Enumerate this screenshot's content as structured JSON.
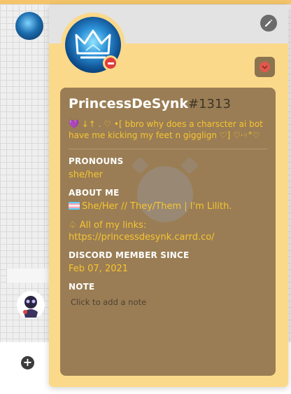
{
  "background": {
    "add_glyph": "+"
  },
  "profile": {
    "username": "PrincessDeSynk",
    "discriminator": "#1313",
    "custom_status": "💜 ↓↑ . ♡ •[ bbro why does a charscter ai bot have me kicking my feet n gigglign ♡] ♡·◦°♡",
    "status": "do-not-disturb",
    "pronouns_title": "PRONOUNS",
    "pronouns": "she/her",
    "about_title": "ABOUT ME",
    "about_line1": "She/Her // They/Them | I'm Lilith.",
    "about_line2": "♤ All of my links:",
    "about_line3": "https://princessdesynk.carrd.co/",
    "member_since_title": "DISCORD MEMBER SINCE",
    "member_since": "Feb 07, 2021",
    "note_title": "NOTE",
    "note_placeholder": "Click to add a note"
  },
  "colors": {
    "card_bg": "#fbd98a",
    "inner_bg": "#9a7d54",
    "accent_text": "#f7c531",
    "dnd_red": "#e03d3d"
  },
  "icons": {
    "edit": "pencil-icon",
    "status": "do-not-disturb-icon",
    "badge": "heart-badge-icon",
    "add": "plus-icon",
    "flag": "transgender-flag-icon"
  }
}
